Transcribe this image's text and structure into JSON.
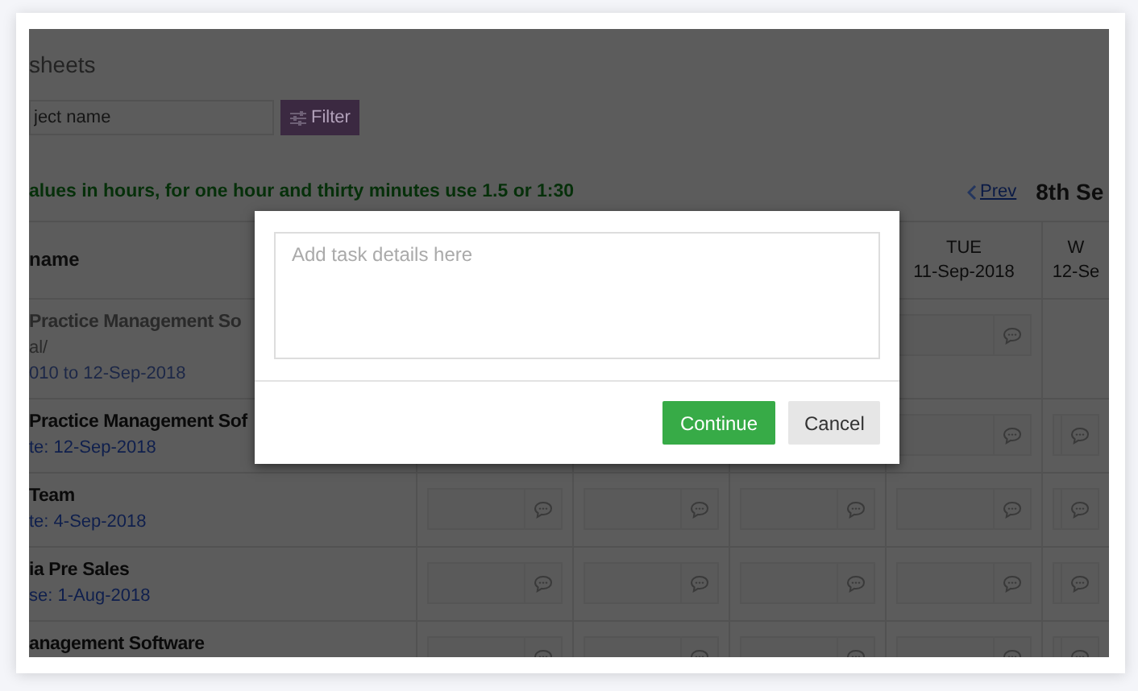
{
  "page": {
    "title": "sheets",
    "search": {
      "placeholder": "ject name"
    },
    "filter_button": "Filter",
    "note": "alues in hours, for one hour and thirty minutes use 1.5 or 1:30",
    "prev_link": "Prev",
    "week_label": "8th Se"
  },
  "table": {
    "name_column": "name",
    "day_columns": [
      {
        "day": "TUE",
        "date": "11-Sep-2018"
      },
      {
        "day": "W",
        "date": "12-Se"
      }
    ],
    "rows": [
      {
        "name": "Practice Management So",
        "detail": "al/",
        "date": "010 to 12-Sep-2018",
        "disabled": true
      },
      {
        "name": "Practice Management Sof",
        "date": "te: 12-Sep-2018",
        "disabled": false
      },
      {
        "name": "Team",
        "date": "te: 4-Sep-2018",
        "disabled": false
      },
      {
        "name": "ia Pre Sales",
        "date": "se: 1-Aug-2018",
        "disabled": false
      },
      {
        "name": "anagement Software",
        "disabled": false
      }
    ]
  },
  "dialog": {
    "placeholder": "Add task details here",
    "buttons": [
      {
        "label": "Continue",
        "kind": "primary"
      },
      {
        "label": "Cancel",
        "kind": "secondary"
      }
    ]
  }
}
